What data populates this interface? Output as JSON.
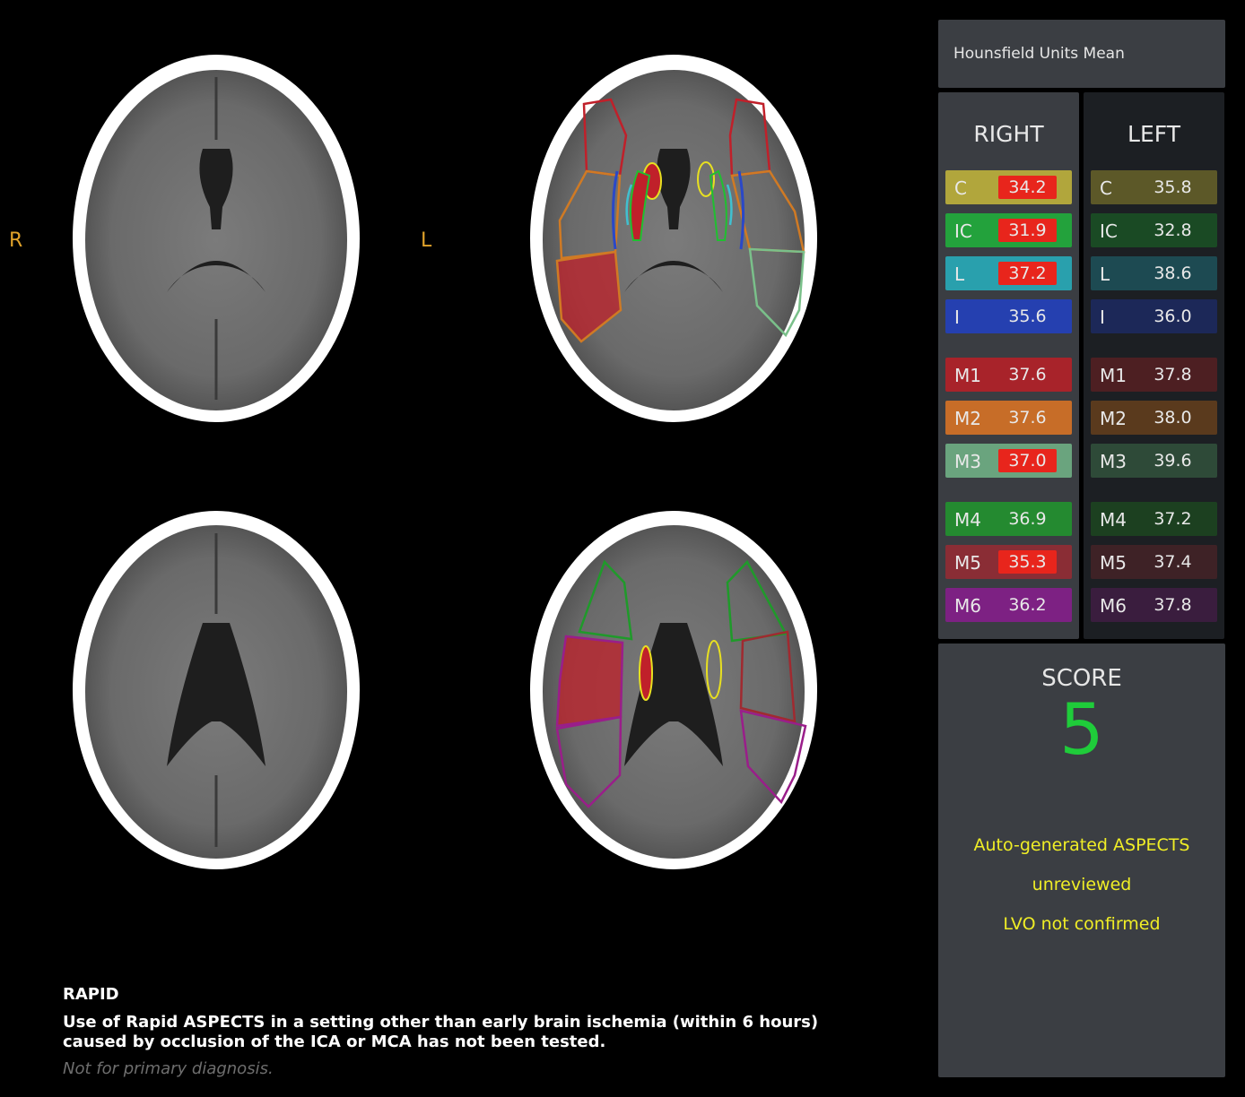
{
  "orientation": {
    "right": "R",
    "left": "L"
  },
  "panel_title": "Hounsfield Units Mean",
  "right": {
    "header": "RIGHT",
    "regions": [
      {
        "label": "C",
        "value": "34.2",
        "flag": true,
        "color": "#b1a63c"
      },
      {
        "label": "IC",
        "value": "31.9",
        "flag": true,
        "color": "#23a23c"
      },
      {
        "label": "L",
        "value": "37.2",
        "flag": true,
        "color": "#29a0ad"
      },
      {
        "label": "I",
        "value": "35.6",
        "flag": false,
        "color": "#2540b0"
      },
      {
        "label": "M1",
        "value": "37.6",
        "flag": false,
        "color": "#a8232a"
      },
      {
        "label": "M2",
        "value": "37.6",
        "flag": false,
        "color": "#c76d28"
      },
      {
        "label": "M3",
        "value": "37.0",
        "flag": true,
        "color": "#6aa47e"
      },
      {
        "label": "M4",
        "value": "36.9",
        "flag": false,
        "color": "#248a30"
      },
      {
        "label": "M5",
        "value": "35.3",
        "flag": true,
        "color": "#8a2d35"
      },
      {
        "label": "M6",
        "value": "36.2",
        "flag": false,
        "color": "#7d2183"
      }
    ]
  },
  "left": {
    "header": "LEFT",
    "regions": [
      {
        "label": "C",
        "value": "35.8",
        "color": "#5c5828"
      },
      {
        "label": "IC",
        "value": "32.8",
        "color": "#1a4a24"
      },
      {
        "label": "L",
        "value": "38.6",
        "color": "#1d4a52"
      },
      {
        "label": "I",
        "value": "36.0",
        "color": "#1c2858"
      },
      {
        "label": "M1",
        "value": "37.8",
        "color": "#4d1f22"
      },
      {
        "label": "M2",
        "value": "38.0",
        "color": "#5a3a1d"
      },
      {
        "label": "M3",
        "value": "39.6",
        "color": "#2e4a38"
      },
      {
        "label": "M4",
        "value": "37.2",
        "color": "#1c4020"
      },
      {
        "label": "M5",
        "value": "37.4",
        "color": "#3e2226"
      },
      {
        "label": "M6",
        "value": "37.8",
        "color": "#3a1d3e"
      }
    ]
  },
  "score": {
    "label": "SCORE",
    "value": "5",
    "notes": [
      "Auto-generated ASPECTS",
      "unreviewed",
      "LVO not confirmed"
    ]
  },
  "disclaimer": {
    "title": "RAPID",
    "text": "Use of Rapid ASPECTS in a setting other than early brain ischemia (within 6 hours) caused by occlusion of the ICA or MCA has not been tested.",
    "note": "Not for primary diagnosis."
  },
  "colors": {
    "flag": "#e8251c",
    "score": "#1fcc3a",
    "warning": "#f0ee26",
    "orientation": "#e0a22a"
  }
}
